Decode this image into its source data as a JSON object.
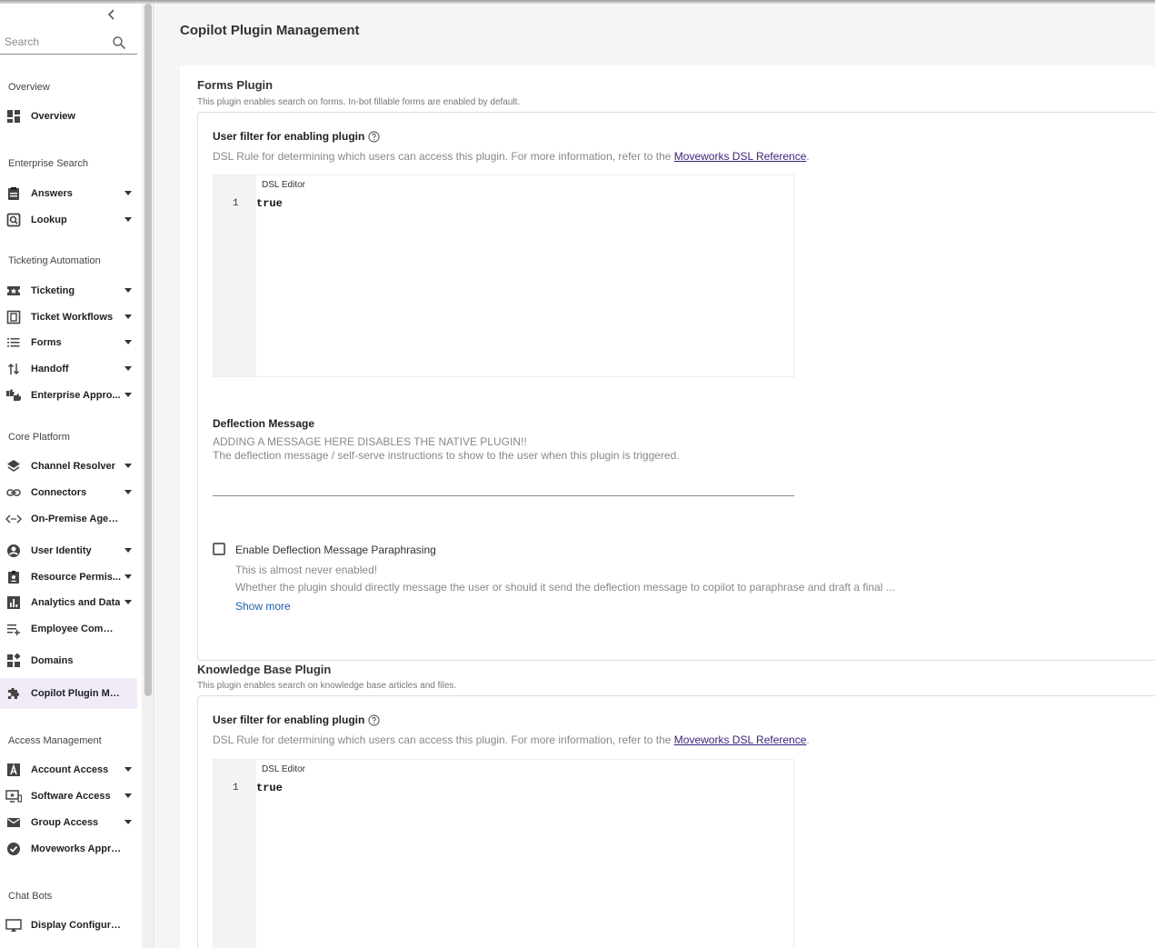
{
  "sidebar": {
    "search_placeholder": "Search",
    "sections": [
      {
        "title": "Overview"
      },
      {
        "title": "Enterprise Search"
      },
      {
        "title": "Ticketing Automation"
      },
      {
        "title": "Core Platform"
      },
      {
        "title": "Access Management"
      },
      {
        "title": "Chat Bots"
      }
    ],
    "items": [
      {
        "label": "Overview",
        "icon": "dashboard-icon",
        "expandable": false
      },
      {
        "label": "Answers",
        "icon": "clipboard-icon",
        "expandable": true
      },
      {
        "label": "Lookup",
        "icon": "search-doc-icon",
        "expandable": true
      },
      {
        "label": "Ticketing",
        "icon": "ticket-icon",
        "expandable": true
      },
      {
        "label": "Ticket Workflows",
        "icon": "workflow-icon",
        "expandable": true
      },
      {
        "label": "Forms",
        "icon": "list-icon",
        "expandable": true
      },
      {
        "label": "Handoff",
        "icon": "swap-vertical-icon",
        "expandable": true
      },
      {
        "label": "Enterprise Appro...",
        "icon": "thumbs-icon",
        "expandable": true
      },
      {
        "label": "Channel Resolver",
        "icon": "layers-icon",
        "expandable": true
      },
      {
        "label": "Connectors",
        "icon": "link-icon",
        "expandable": true
      },
      {
        "label": "On-Premise Agents",
        "icon": "code-dots-icon",
        "expandable": false
      },
      {
        "label": "User Identity",
        "icon": "account-circle-icon",
        "expandable": true
      },
      {
        "label": "Resource Permis...",
        "icon": "badge-icon",
        "expandable": true
      },
      {
        "label": "Analytics and Data",
        "icon": "bar-chart-icon",
        "expandable": true
      },
      {
        "label": "Employee Commu...",
        "icon": "playlist-add-icon",
        "expandable": false
      },
      {
        "label": "Domains",
        "icon": "widgets-icon",
        "expandable": false
      },
      {
        "label": "Copilot Plugin Ma...",
        "icon": "puzzle-icon",
        "expandable": false,
        "active": true
      },
      {
        "label": "Account Access",
        "icon": "letter-a-icon",
        "expandable": true
      },
      {
        "label": "Software Access",
        "icon": "monitor-star-icon",
        "expandable": true
      },
      {
        "label": "Group Access",
        "icon": "mail-icon",
        "expandable": true
      },
      {
        "label": "Moveworks Appro...",
        "icon": "check-circle-icon",
        "expandable": false
      },
      {
        "label": "Display Configurati...",
        "icon": "cast-icon",
        "expandable": false
      }
    ]
  },
  "main": {
    "page_title": "Copilot Plugin Management",
    "plugins": [
      {
        "title": "Forms Plugin",
        "description": "This plugin enables search on forms. In-bot fillable forms are enabled by default.",
        "user_filter_label": "User filter for enabling plugin",
        "user_filter_desc": "DSL Rule for determining which users can access this plugin. For more information, refer to the ",
        "dsl_link": "Moveworks DSL Reference",
        "dsl_link_suffix": ".",
        "editor_title": "DSL Editor",
        "editor_line": "1",
        "editor_code": "true",
        "deflection_label": "Deflection Message",
        "deflection_desc_1": "ADDING A MESSAGE HERE DISABLES THE NATIVE PLUGIN!!",
        "deflection_desc_2": "The deflection message / self-serve instructions to show to the user when this plugin is triggered.",
        "paraphrase_label": "Enable Deflection Message Paraphrasing",
        "paraphrase_desc_1": "This is almost never enabled!",
        "paraphrase_desc_2": "Whether the plugin should directly message the user or should it send the deflection message to copilot to paraphrase and draft a final ...",
        "show_more": "Show more"
      },
      {
        "title": "Knowledge Base Plugin",
        "description": "This plugin enables search on knowledge base articles and files.",
        "user_filter_label": "User filter for enabling plugin",
        "user_filter_desc": "DSL Rule for determining which users can access this plugin. For more information, refer to the ",
        "dsl_link": "Moveworks DSL Reference",
        "dsl_link_suffix": ".",
        "editor_title": "DSL Editor",
        "editor_line": "1",
        "editor_code": "true"
      }
    ]
  },
  "colors": {
    "active_bg": "#f1ebf8",
    "link": "#1a5fb4",
    "dsl_link": "#3a1f7a"
  }
}
